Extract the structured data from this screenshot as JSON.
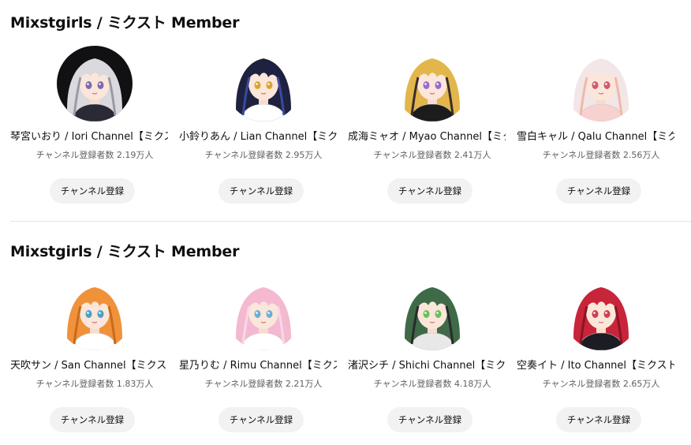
{
  "sections": [
    {
      "title": "Mixstgirls / ミクスト Member",
      "channels": [
        {
          "name": "琴宮いおり / Iori Channel【ミクスト】",
          "subs": "チャンネル登録者数 2.19万人",
          "button": "チャンネル登録",
          "hair": "#d9d9de",
          "hair2": "#9a9aa4",
          "eyes": "#7b6bb0",
          "outfit": "#2a2a36",
          "bg": "#111114",
          "icon": "avatar-iori-icon"
        },
        {
          "name": "小鈴りあん / Lian Channel【ミクスト】",
          "subs": "チャンネル登録者数 2.95万人",
          "button": "チャンネル登録",
          "hair": "#1e2240",
          "hair2": "#3a4aa0",
          "eyes": "#d6a630",
          "outfit": "#ffffff",
          "bg": "#ffffff",
          "icon": "avatar-lian-icon"
        },
        {
          "name": "成海ミャオ / Myao Channel【ミクスト】",
          "subs": "チャンネル登録者数 2.41万人",
          "button": "チャンネル登録",
          "hair": "#e2b64a",
          "hair2": "#3a2c2c",
          "eyes": "#9a6ad0",
          "outfit": "#1c1c1c",
          "bg": "#ffffff",
          "icon": "avatar-myao-icon"
        },
        {
          "name": "雪白キャル / Qalu Channel【ミクスト】",
          "subs": "チャンネル登録者数 2.56万人",
          "button": "チャンネル登録",
          "hair": "#f2e6e6",
          "hair2": "#f0b8a8",
          "eyes": "#d05a70",
          "outfit": "#f7d0d0",
          "bg": "#ffffff",
          "icon": "avatar-qalu-icon"
        }
      ]
    },
    {
      "title": "Mixstgirls / ミクスト Member",
      "channels": [
        {
          "name": "天吹サン / San Channel【ミクスト】",
          "subs": "チャンネル登録者数 1.83万人",
          "button": "チャンネル登録",
          "hair": "#f0923a",
          "hair2": "#c86a20",
          "eyes": "#4aa0c8",
          "outfit": "#ffffff",
          "bg": "#ffffff",
          "icon": "avatar-san-icon"
        },
        {
          "name": "星乃りむ / Rimu Channel【ミクスト】",
          "subs": "チャンネル登録者数 2.21万人",
          "button": "チャンネル登録",
          "hair": "#f4b8d0",
          "hair2": "#f8d8e6",
          "eyes": "#6ab0d8",
          "outfit": "#ffffff",
          "bg": "#ffffff",
          "icon": "avatar-rimu-icon"
        },
        {
          "name": "渚沢シチ / Shichi Channel【ミクスト】",
          "subs": "チャンネル登録者数 4.18万人",
          "button": "チャンネル登録",
          "hair": "#3f6a48",
          "hair2": "#2a2a2a",
          "eyes": "#6ac05a",
          "outfit": "#e8e8e8",
          "bg": "#ffffff",
          "icon": "avatar-shichi-icon"
        },
        {
          "name": "空奏イト / Ito Channel【ミクスト】",
          "subs": "チャンネル登録者数 2.65万人",
          "button": "チャンネル登録",
          "hair": "#c8243a",
          "hair2": "#8a1426",
          "eyes": "#d04050",
          "outfit": "#1c1c24",
          "bg": "#ffffff",
          "icon": "avatar-ito-icon"
        }
      ]
    }
  ]
}
